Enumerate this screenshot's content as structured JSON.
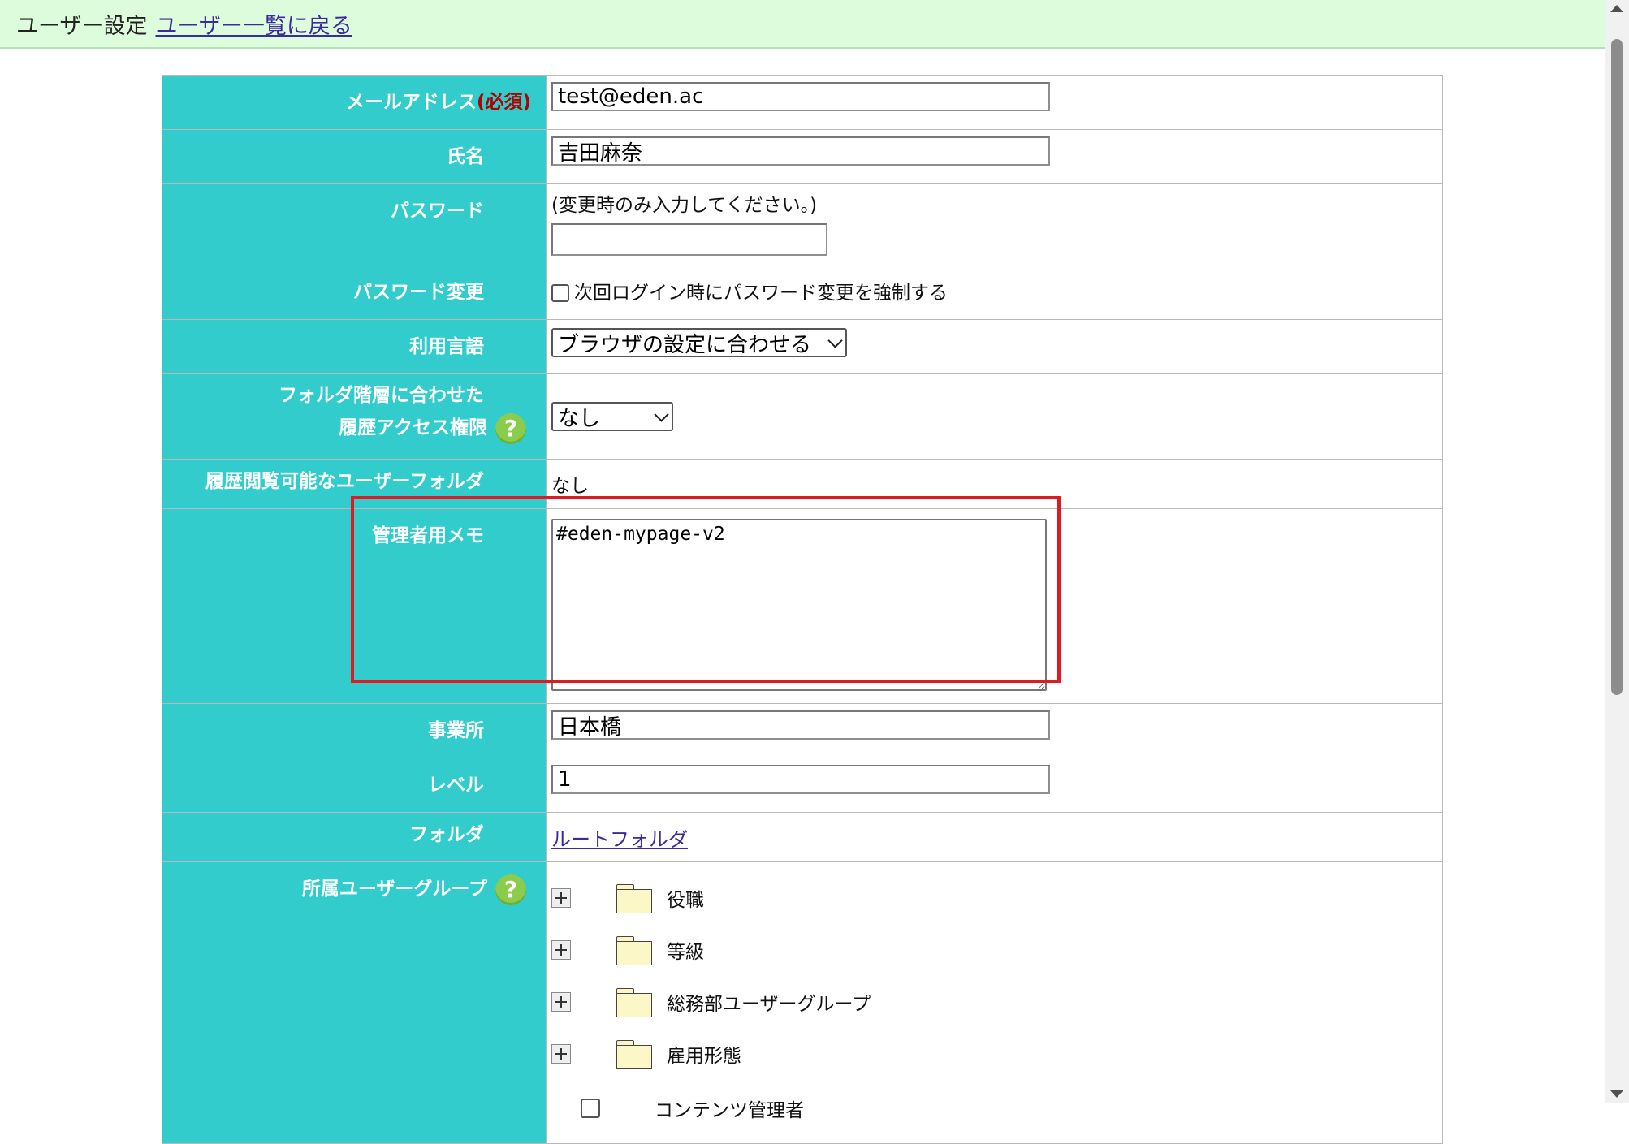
{
  "header": {
    "title": "ユーザー設定",
    "back_link": "ユーザー一覧に戻る"
  },
  "form": {
    "email": {
      "label": "メールアドレス",
      "required": "(必須)",
      "value": "test@eden.ac"
    },
    "name": {
      "label": "氏名",
      "value": "吉田麻奈"
    },
    "password": {
      "label": "パスワード",
      "hint": "(変更時のみ入力してください。)",
      "value": ""
    },
    "password_change": {
      "label": "パスワード変更",
      "checkbox_label": "次回ログイン時にパスワード変更を強制する"
    },
    "language": {
      "label": "利用言語",
      "selected": "ブラウザの設定に合わせる"
    },
    "history_access": {
      "label_line1": "フォルダ階層に合わせた",
      "label_line2": "履歴アクセス権限",
      "selected": "なし"
    },
    "history_folder": {
      "label": "履歴閲覧可能なユーザーフォルダ",
      "value": "なし"
    },
    "admin_memo": {
      "label": "管理者用メモ",
      "value": "#eden-mypage-v2"
    },
    "office": {
      "label": "事業所",
      "value": "日本橋"
    },
    "level": {
      "label": "レベル",
      "value": "1"
    },
    "folder": {
      "label": "フォルダ",
      "link": "ルートフォルダ"
    },
    "user_groups": {
      "label": "所属ユーザーグループ",
      "tree": [
        {
          "label": "役職"
        },
        {
          "label": "等級"
        },
        {
          "label": "総務部ユーザーグループ"
        },
        {
          "label": "雇用形態"
        }
      ],
      "group_item": "コンテンツ管理者"
    }
  },
  "colors": {
    "label_bg": "#33cccc",
    "header_bg": "#dcfcdc",
    "highlight": "#e01a22",
    "required": "#b00000",
    "link": "#3b2aa0"
  }
}
